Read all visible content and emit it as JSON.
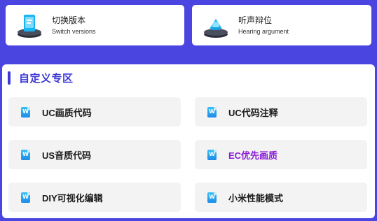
{
  "top_cards": [
    {
      "title": "切换版本",
      "subtitle": "Switch versions",
      "icon": "phone-stand-icon"
    },
    {
      "title": "听声辩位",
      "subtitle": "Hearing argument",
      "icon": "device-stand-icon"
    }
  ],
  "panel": {
    "title": "自定义专区",
    "items": [
      {
        "label": "UC画质代码",
        "icon": "document-icon"
      },
      {
        "label": "UC代码注释",
        "icon": "document-icon"
      },
      {
        "label": "US音质代码",
        "icon": "document-icon"
      },
      {
        "label": "EC优先画质",
        "icon": "document-icon",
        "color": "#8a1ed8"
      },
      {
        "label": "DIY可视化编辑",
        "icon": "document-icon"
      },
      {
        "label": "小米性能模式",
        "icon": "document-icon"
      }
    ]
  },
  "colors": {
    "background": "#4a44e0",
    "accent": "#3d38d6",
    "highlight": "#8a1ed8"
  }
}
